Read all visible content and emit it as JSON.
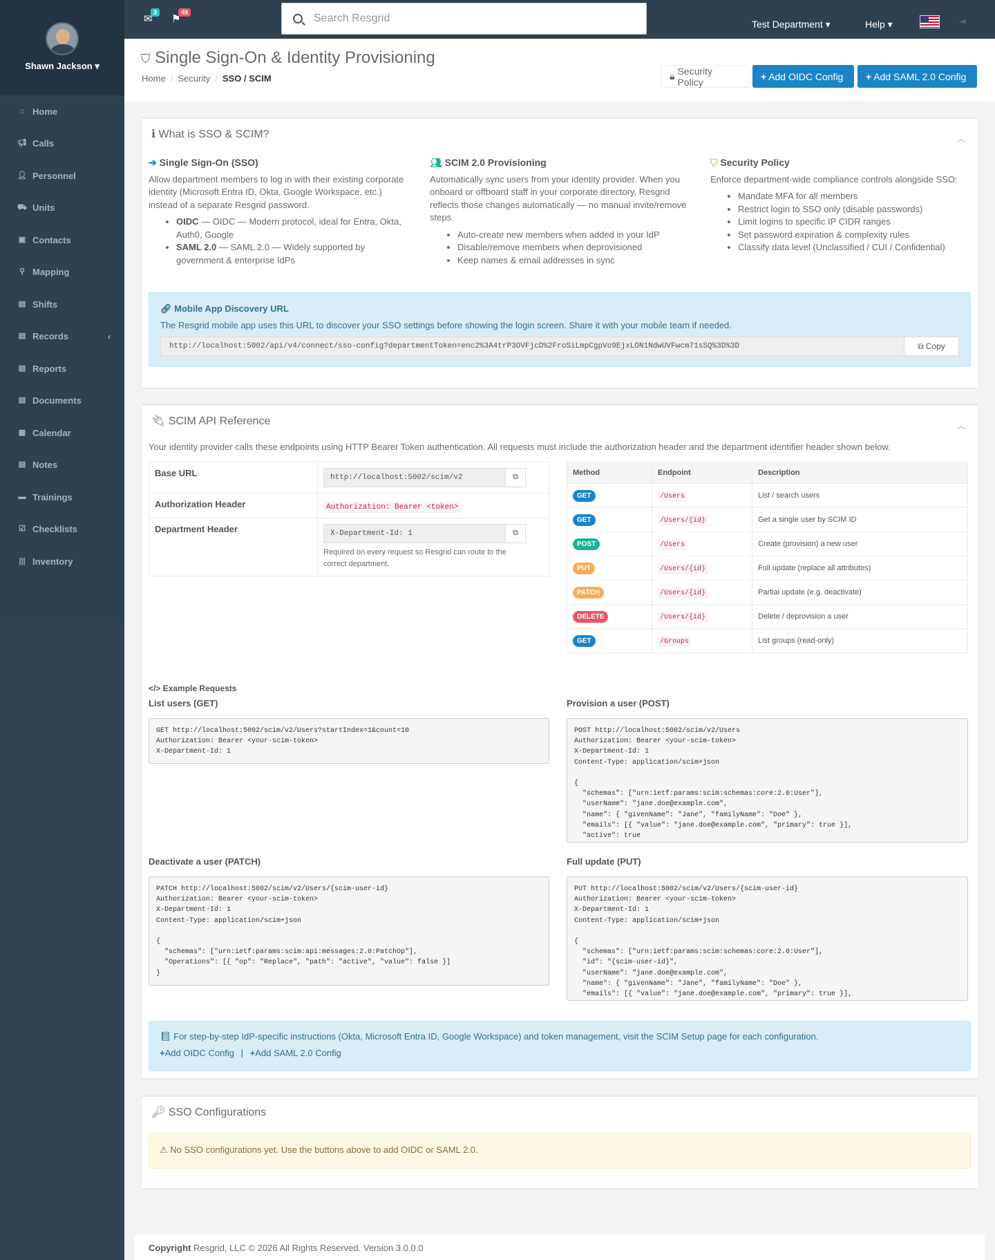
{
  "user": {
    "name": "Shawn Jackson"
  },
  "sidebar": {
    "items": [
      {
        "label": "Home",
        "icon": "home-icon"
      },
      {
        "label": "Calls",
        "icon": "bullhorn-icon"
      },
      {
        "label": "Personnel",
        "icon": "user-icon"
      },
      {
        "label": "Units",
        "icon": "truck-icon"
      },
      {
        "label": "Contacts",
        "icon": "address-book-icon"
      },
      {
        "label": "Mapping",
        "icon": "map-marker-icon"
      },
      {
        "label": "Shifts",
        "icon": "shifts-icon"
      },
      {
        "label": "Records",
        "icon": "file-icon"
      },
      {
        "label": "Reports",
        "icon": "reports-icon"
      },
      {
        "label": "Documents",
        "icon": "document-icon"
      },
      {
        "label": "Calendar",
        "icon": "calendar-icon"
      },
      {
        "label": "Notes",
        "icon": "notes-icon"
      },
      {
        "label": "Trainings",
        "icon": "book-icon"
      },
      {
        "label": "Checklists",
        "icon": "checklist-icon"
      },
      {
        "label": "Inventory",
        "icon": "barcode-icon"
      }
    ]
  },
  "topbar": {
    "mail_count": "3",
    "alert_count": "49",
    "search_placeholder": "Search Resgrid",
    "department": "Test Department",
    "help": "Help",
    "colors": {
      "mail_badge": "#23c6c8",
      "alert_badge": "#ed5565"
    }
  },
  "page": {
    "title": "Single Sign-On & Identity Provisioning",
    "breadcrumb": [
      "Home",
      "Security",
      "SSO / SCIM"
    ],
    "buttons": {
      "security_policy": "Security Policy",
      "add_oidc": "Add OIDC Config",
      "add_saml": "Add SAML 2.0 Config"
    }
  },
  "what": {
    "title": "What is SSO & SCIM?",
    "sso": {
      "title": "Single Sign-On (SSO)",
      "body": "Allow department members to log in with their existing corporate identity (Microsoft Entra ID, Okta, Google Workspace, etc.) instead of a separate Resgrid password.",
      "items": [
        {
          "b": "OIDC",
          "t": " — OIDC — Modern protocol, ideal for Entra, Okta, Auth0, Google"
        },
        {
          "b": "SAML 2.0",
          "t": " — SAML 2.0 — Widely supported by government & enterprise IdPs"
        }
      ]
    },
    "scim": {
      "title": "SCIM 2.0 Provisioning",
      "body": "Automatically sync users from your identity provider. When you onboard or offboard staff in your corporate directory, Resgrid reflects those changes automatically — no manual invite/remove steps.",
      "items": [
        "Auto-create new members when added in your IdP",
        "Disable/remove members when deprovisioned",
        "Keep names & email addresses in sync"
      ]
    },
    "policy": {
      "title": "Security Policy",
      "body": "Enforce department-wide compliance controls alongside SSO:",
      "items": [
        "Mandate MFA for all members",
        "Restrict login to SSO only (disable passwords)",
        "Limit logins to specific IP CIDR ranges",
        "Set password expiration & complexity rules",
        "Classify data level (Unclassified / CUI / Confidential)"
      ]
    },
    "discovery": {
      "title": "Mobile App Discovery URL",
      "body": "The Resgrid mobile app uses this URL to discover your SSO settings before showing the login screen. Share it with your mobile team if needed.",
      "url": "http://localhost:5002/api/v4/connect/sso-config?departmentToken=enc2%3A4trP3OVFjcD%2FroSiLmpCgpVo9EjxLON1NdwUVFwcm71sSQ%3D%3D",
      "copy": "Copy"
    }
  },
  "scim_ref": {
    "title": "SCIM API Reference",
    "intro": "Your identity provider calls these endpoints using HTTP Bearer Token authentication. All requests must include the authorization header and the department identifier header shown below.",
    "base_url_label": "Base URL",
    "base_url": "http://localhost:5002/scim/v2",
    "auth_label": "Authorization Header",
    "auth_value": "Authorization: Bearer <token>",
    "dept_label": "Department Header",
    "dept_value": "X-Department-Id: 1",
    "dept_note": "Required on every request so Resgrid can route to the correct department.",
    "headers": [
      "Method",
      "Endpoint",
      "Description"
    ],
    "endpoints": [
      {
        "method": "GET",
        "path": "/Users",
        "desc": "List / search users"
      },
      {
        "method": "GET",
        "path": "/Users/{id}",
        "desc": "Get a single user by SCIM ID"
      },
      {
        "method": "POST",
        "path": "/Users",
        "desc": "Create (provision) a new user"
      },
      {
        "method": "PUT",
        "path": "/Users/{id}",
        "desc": "Full update (replace all attributes)"
      },
      {
        "method": "PATCH",
        "path": "/Users/{id}",
        "desc": "Partial update (e.g. deactivate)"
      },
      {
        "method": "DELETE",
        "path": "/Users/{id}",
        "desc": "Delete / deprovision a user"
      },
      {
        "method": "GET",
        "path": "/Groups",
        "desc": "List groups (read-only)"
      }
    ],
    "examples_title": "Example Requests",
    "ex1_label": "List users (GET)",
    "ex1": "GET http://localhost:5002/scim/v2/Users?startIndex=1&count=10\nAuthorization: Bearer <your-scim-token>\nX-Department-Id: 1",
    "ex2_label": "Provision a user (POST)",
    "ex2": "POST http://localhost:5002/scim/v2/Users\nAuthorization: Bearer <your-scim-token>\nX-Department-Id: 1\nContent-Type: application/scim+json\n\n{\n  \"schemas\": [\"urn:ietf:params:scim:schemas:core:2.0:User\"],\n  \"userName\": \"jane.doe@example.com\",\n  \"name\": { \"givenName\": \"Jane\", \"familyName\": \"Doe\" },\n  \"emails\": [{ \"value\": \"jane.doe@example.com\", \"primary\": true }],\n  \"active\": true",
    "ex3_label": "Deactivate a user (PATCH)",
    "ex3": "PATCH http://localhost:5002/scim/v2/Users/{scim-user-id}\nAuthorization: Bearer <your-scim-token>\nX-Department-Id: 1\nContent-Type: application/scim+json\n\n{\n  \"schemas\": [\"urn:ietf:params:scim:api:messages:2.0:PatchOp\"],\n  \"Operations\": [{ \"op\": \"Replace\", \"path\": \"active\", \"value\": false }]\n}",
    "ex4_label": "Full update (PUT)",
    "ex4": "PUT http://localhost:5002/scim/v2/Users/{scim-user-id}\nAuthorization: Bearer <your-scim-token>\nX-Department-Id: 1\nContent-Type: application/scim+json\n\n{\n  \"schemas\": [\"urn:ietf:params:scim:schemas:core:2.0:User\"],\n  \"id\": \"{scim-user-id}\",\n  \"userName\": \"jane.doe@example.com\",\n  \"name\": { \"givenName\": \"Jane\", \"familyName\": \"Doe\" },\n  \"emails\": [{ \"value\": \"jane.doe@example.com\", \"primary\": true }],",
    "note": "For step-by-step IdP-specific instructions (Okta, Microsoft Entra ID, Google Workspace) and token management, visit the SCIM Setup page for each configuration.",
    "note_add_oidc": "Add OIDC Config",
    "note_add_saml": "Add SAML 2.0 Config"
  },
  "configs": {
    "title": "SSO Configurations",
    "empty": "No SSO configurations yet. Use the buttons above to add OIDC or SAML 2.0."
  },
  "footer": {
    "bold": "Copyright",
    "text": " Resgrid, LLC © 2026 All Rights Reserved. Version 3.0.0.0"
  }
}
